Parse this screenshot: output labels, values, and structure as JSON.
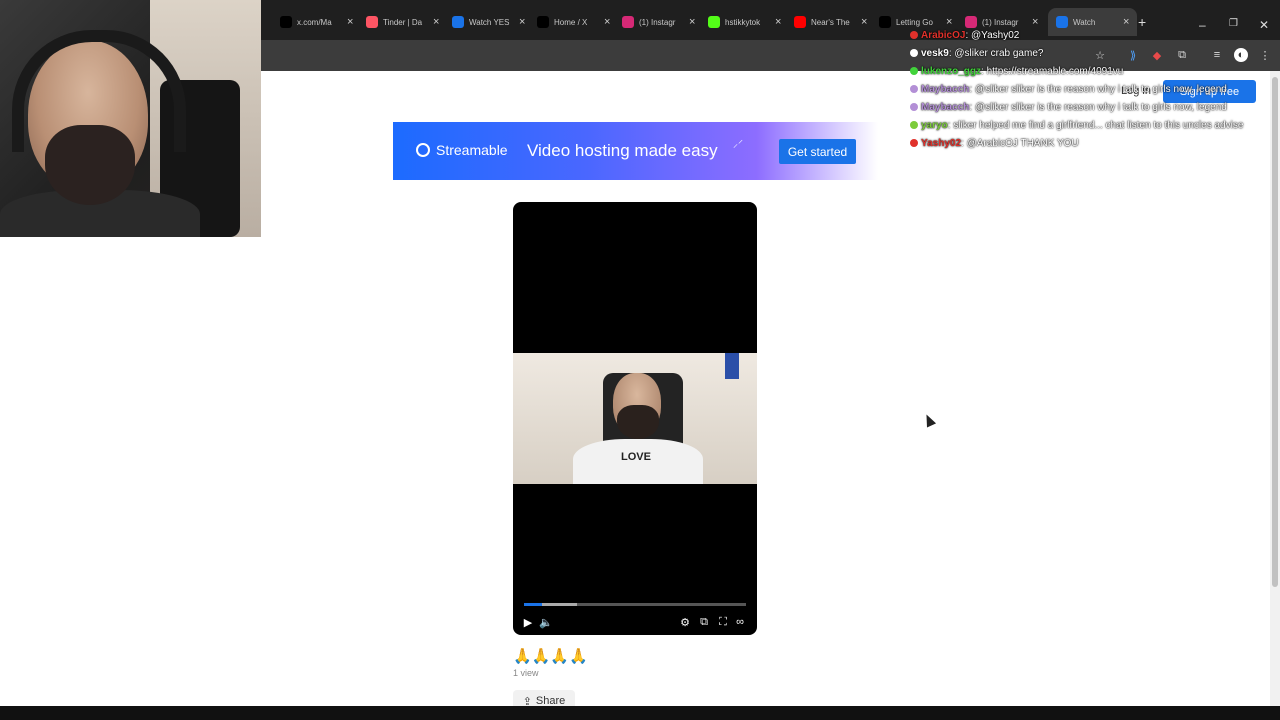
{
  "browser": {
    "tabs": [
      {
        "title": "x.com/Ma",
        "icon": "x-icon",
        "color": "#000000"
      },
      {
        "title": "Tinder | Da",
        "icon": "tinder-icon",
        "color": "#fd5564"
      },
      {
        "title": "Watch YES",
        "icon": "streamable-icon",
        "color": "#1a73e8"
      },
      {
        "title": "Home / X",
        "icon": "x-icon",
        "color": "#000000"
      },
      {
        "title": "(1) Instagr",
        "icon": "instagram-icon",
        "color": "#d62976"
      },
      {
        "title": "hstikkytok",
        "icon": "kick-icon",
        "color": "#53fc18"
      },
      {
        "title": "Near's The",
        "icon": "youtube-icon",
        "color": "#ff0000"
      },
      {
        "title": "Letting Go",
        "icon": "tiktok-icon",
        "color": "#000000"
      },
      {
        "title": "(1) Instagr",
        "icon": "instagram-icon",
        "color": "#d62976"
      },
      {
        "title": "Watch",
        "icon": "streamable-icon",
        "color": "#1a73e8",
        "active": true
      }
    ],
    "new_tab": "+",
    "close_glyph": "×"
  },
  "banner": {
    "brand": "Streamable",
    "tagline": "Video hosting made easy",
    "cta": "Get started"
  },
  "header": {
    "login": "Log in",
    "signup": "Sign up free"
  },
  "video": {
    "title": "🙏🙏🙏🙏",
    "views": "1 view",
    "share": "Share",
    "shirt_text": "LOVE",
    "progress_played": 0.08,
    "progress_buffered": 0.24
  },
  "chat": [
    {
      "user": "ArabicOJ",
      "message": ": @Yashy02",
      "color": "#e0312b"
    },
    {
      "user": "vesk9",
      "message": ": @sliker crab game?",
      "color": "#ffffff"
    },
    {
      "user": "lukenzo_ggz",
      "message": ": https://streamable.com/4091vu",
      "color": "#41d33b"
    },
    {
      "user": "Maybacch",
      "message": ": @sliker sliker is the reason why i talk to girls now, legend",
      "color": "#b38fd6"
    },
    {
      "user": "Maybacch",
      "message": ": @sliker sliker is the reason why i talk to girls now, legend",
      "color": "#b38fd6"
    },
    {
      "user": "yaryo",
      "message": ": sliker helped me find a girlfriend... chat listen to this uncles advise",
      "color": "#7ccc3a"
    },
    {
      "user": "Yashy02",
      "message": ": @ArabicOJ THANK YOU",
      "color": "#e0312b"
    }
  ]
}
